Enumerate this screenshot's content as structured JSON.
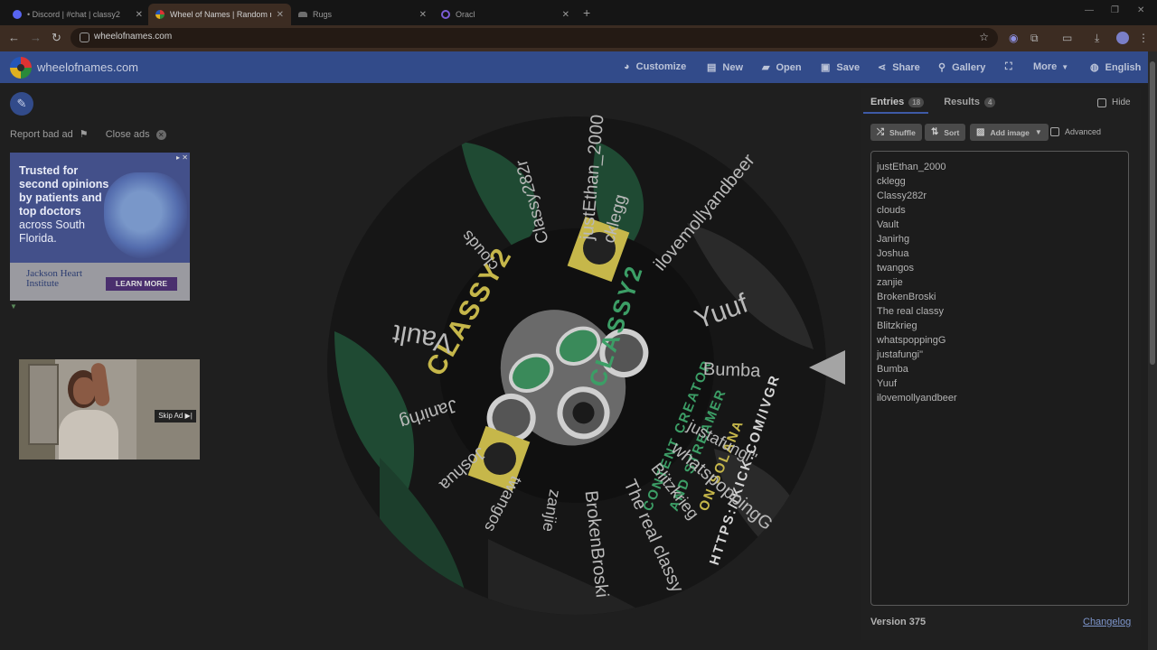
{
  "browser": {
    "tabs": [
      {
        "label": "• Discord | #chat | classy2",
        "color": "#5865f2"
      },
      {
        "label": "Wheel of Names | Random nam",
        "color": "#e1412f",
        "active": true
      },
      {
        "label": "Rugs",
        "color": "#9a9a9a"
      },
      {
        "label": "Oracl",
        "color": "#7b5cd6"
      }
    ],
    "url": "wheelofnames.com"
  },
  "header": {
    "brand": "wheelofnames.com",
    "menu": {
      "customize": "Customize",
      "new": "New",
      "open": "Open",
      "save": "Save",
      "share": "Share",
      "gallery": "Gallery",
      "more": "More",
      "language": "English"
    }
  },
  "ads": {
    "report": "Report bad ad",
    "close": "Close ads",
    "ad1_line1": "Trusted for second opinions by patients and top doctors",
    "ad1_line2": "across South Florida.",
    "ad1_brand": "Jackson Heart Institute",
    "ad1_cta": "LEARN MORE",
    "skip": "Skip Ad ▶|"
  },
  "wheel": {
    "center_text": "CLASSY2",
    "entries_on_wheel": [
      "justEthan_2000",
      "cklegg",
      "Classy282r",
      "clouds",
      "Vault",
      "Janirhg",
      "Joshua",
      "twangos",
      "zanjie",
      "BrokenBroski",
      "The real classy",
      "Blitzkrieg",
      "whatspoppingG",
      "justafungi\"",
      "Bumba",
      "Yuuf",
      "ilovemollyandbeer"
    ],
    "image_text": [
      "CLASSY2",
      "CONTENT CREATOR",
      "AND STREAMER",
      "ON SOLANA",
      "HTTPS://KICK.COM/IVGR"
    ]
  },
  "panel": {
    "tab_entries": "Entries",
    "entries_count": "18",
    "tab_results": "Results",
    "results_count": "4",
    "hide": "Hide",
    "shuffle": "Shuffle",
    "sort": "Sort",
    "add_image": "Add image",
    "advanced": "Advanced",
    "entries": [
      "justEthan_2000",
      "cklegg",
      "Classy282r",
      "clouds",
      "Vault",
      "Janirhg",
      "Joshua",
      "twangos",
      "zanjie",
      "BrokenBroski",
      "The real classy",
      "Blitzkrieg",
      "whatspoppingG",
      "justafungi\"",
      "Bumba",
      "Yuuf",
      "ilovemollyandbeer"
    ],
    "version": "Version 375",
    "changelog": "Changelog"
  }
}
